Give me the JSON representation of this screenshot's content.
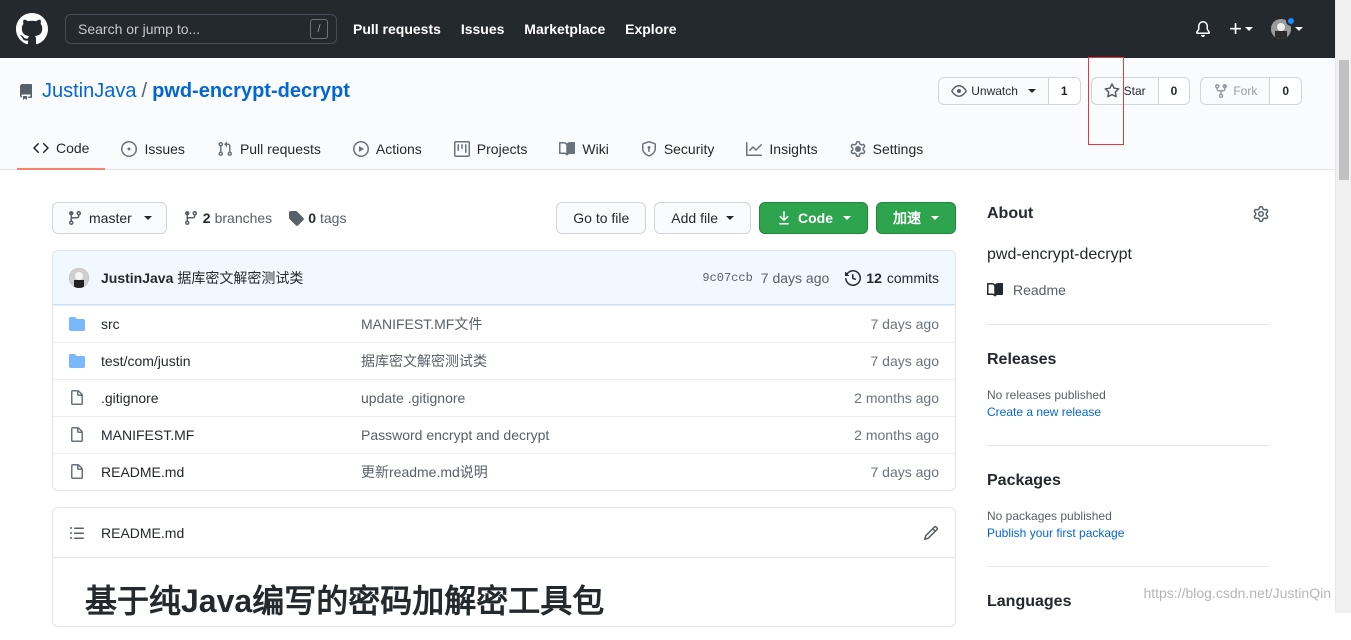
{
  "header": {
    "search_placeholder": "Search or jump to...",
    "search_shortcut": "/",
    "nav": [
      "Pull requests",
      "Issues",
      "Marketplace",
      "Explore"
    ]
  },
  "repo": {
    "owner": "JustinJava",
    "separator": "/",
    "name": "pwd-encrypt-decrypt",
    "watch_label": "Unwatch",
    "watch_count": "1",
    "star_label": "Star",
    "star_count": "0",
    "fork_label": "Fork",
    "fork_count": "0"
  },
  "tabs": [
    {
      "label": "Code",
      "icon": "code-icon",
      "selected": true
    },
    {
      "label": "Issues",
      "icon": "issue-icon"
    },
    {
      "label": "Pull requests",
      "icon": "pull-request-icon"
    },
    {
      "label": "Actions",
      "icon": "play-icon"
    },
    {
      "label": "Projects",
      "icon": "project-icon"
    },
    {
      "label": "Wiki",
      "icon": "book-icon"
    },
    {
      "label": "Security",
      "icon": "shield-icon"
    },
    {
      "label": "Insights",
      "icon": "graph-icon"
    },
    {
      "label": "Settings",
      "icon": "gear-icon"
    }
  ],
  "branchbar": {
    "branch": "master",
    "branches_count": "2",
    "branches_label": "branches",
    "tags_count": "0",
    "tags_label": "tags",
    "go_to_file": "Go to file",
    "add_file": "Add file",
    "code": "Code",
    "accelerate": "加速"
  },
  "commit": {
    "author": "JustinJava",
    "message": "据库密文解密测试类",
    "sha": "9c07ccb",
    "age": "7 days ago",
    "commits_count": "12",
    "commits_label": "commits"
  },
  "files": [
    {
      "type": "dir",
      "name": "src",
      "message": "MANIFEST.MF文件",
      "age": "7 days ago"
    },
    {
      "type": "dir",
      "name": "test/com/justin",
      "message": "据库密文解密测试类",
      "age": "7 days ago"
    },
    {
      "type": "file",
      "name": ".gitignore",
      "message": "update .gitignore",
      "age": "2 months ago"
    },
    {
      "type": "file",
      "name": "MANIFEST.MF",
      "message": "Password encrypt and decrypt",
      "age": "2 months ago"
    },
    {
      "type": "file",
      "name": "README.md",
      "message": "更新readme.md说明",
      "age": "7 days ago"
    }
  ],
  "readme": {
    "filename": "README.md",
    "heading": "基于纯Java编写的密码加解密工具包"
  },
  "sidebar": {
    "about_title": "About",
    "description": "pwd-encrypt-decrypt",
    "readme_label": "Readme",
    "releases_title": "Releases",
    "releases_none": "No releases published",
    "releases_link": "Create a new release",
    "packages_title": "Packages",
    "packages_none": "No packages published",
    "packages_link": "Publish your first package",
    "languages_title": "Languages"
  },
  "watermark": "https://blog.csdn.net/JustinQin",
  "colors": {
    "header_bg": "#24292e",
    "link": "#0366d6",
    "green_button": "#2ea44f",
    "tab_underline": "#f9826c",
    "highlight_box": "#e03c3c"
  }
}
